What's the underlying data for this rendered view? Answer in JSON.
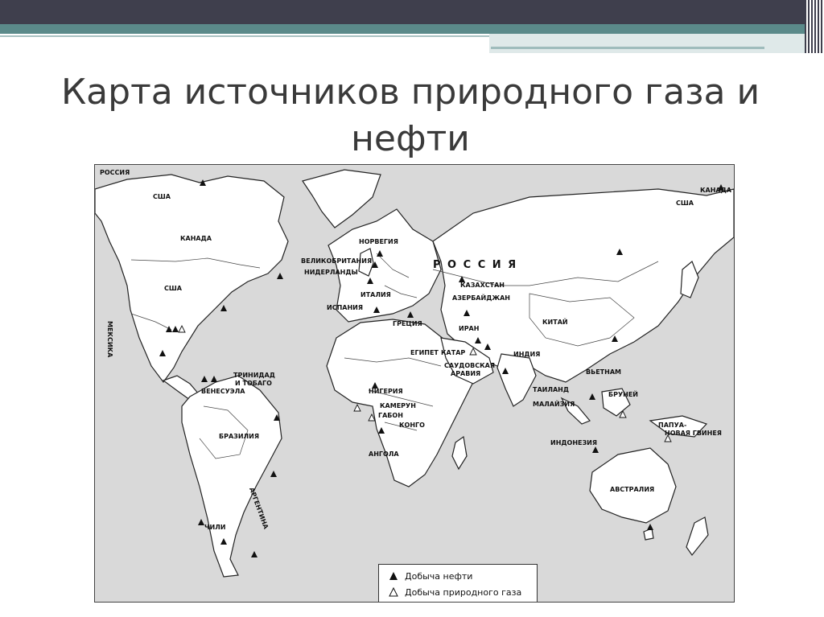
{
  "title": "Карта источников природного газа и нефти",
  "legend": {
    "oil": "Добыча нефти",
    "gas": "Добыча природного газа"
  },
  "labels": {
    "russia_corner": "РОССИЯ",
    "usa_alaska": "США",
    "canada_east": "КАНАДА",
    "usa_east": "США",
    "canada": "КАНАДА",
    "usa": "США",
    "mexico": "МЕКСИКА",
    "trinidad_1": "ТРИНИДАД",
    "trinidad_2": "И ТОБАГО",
    "venezuela": "ВЕНЕСУЭЛА",
    "brazil": "БРАЗИЛИЯ",
    "argentina": "АРГЕНТИНА",
    "chile": "ЧИЛИ",
    "norway": "НОРВЕГИЯ",
    "uk": "ВЕЛИКОБРИТАНИЯ",
    "netherlands": "НИДЕРЛАНДЫ",
    "italy": "ИТАЛИЯ",
    "spain": "ИСПАНИЯ",
    "greece": "ГРЕЦИЯ",
    "egypt": "ЕГИПЕТ",
    "nigeria": "НИГЕРИЯ",
    "cameroon": "КАМЕРУН",
    "gabon": "ГАБОН",
    "congo": "КОНГО",
    "angola": "АНГОЛА",
    "russia_big": "Р О С С И Я",
    "kazakhstan": "КАЗАХСТАН",
    "azerbaijan": "АЗЕРБАЙДЖАН",
    "iran": "ИРАН",
    "qatar": "КАТАР",
    "saudi_1": "САУДОВСКАЯ",
    "saudi_2": "АРАВИЯ",
    "china": "КИТАЙ",
    "india": "ИНДИЯ",
    "vietnam": "ВЬЕТНАМ",
    "thailand": "ТАИЛАНД",
    "brunei": "БРУНЕЙ",
    "malaysia": "МАЛАЙЗИЯ",
    "indonesia": "ИНДОНЕЗИЯ",
    "png_1": "ПАПУА-",
    "png_2": "НОВАЯ ГВИНЕЯ",
    "australia": "АВСТРАЛИЯ"
  },
  "colors": {
    "header_dark": "#3f3f4d",
    "header_teal": "#5b8a8a",
    "ocean": "#d9d9d9",
    "land": "#ffffff"
  }
}
